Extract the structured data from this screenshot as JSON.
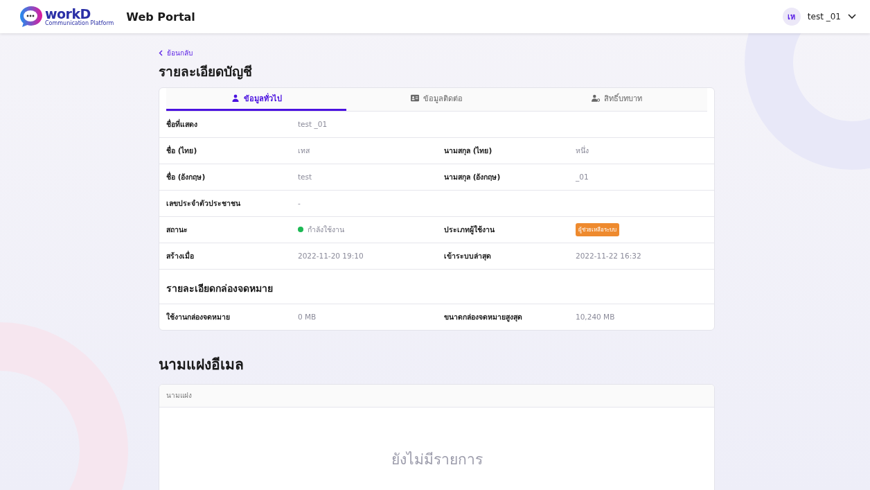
{
  "header": {
    "logo": {
      "name": "workD",
      "tagline": "Communication Platform"
    },
    "title": "Web Portal",
    "user": {
      "initials": "เห",
      "name": "test _01"
    }
  },
  "back_link": "ย้อนกลับ",
  "page_title": "รายละเอียดบัญชี",
  "tabs": [
    {
      "label": "ข้อมูลทั่วไป",
      "selected": true
    },
    {
      "label": "ข้อมูลติดต่อ",
      "selected": false
    },
    {
      "label": "สิทธิ์บทบาท",
      "selected": false
    }
  ],
  "details": [
    {
      "kind": "fields",
      "fields": [
        {
          "label": "ชื่อที่แสดง",
          "value": "test _01"
        }
      ]
    },
    {
      "kind": "fields",
      "fields": [
        {
          "label": "ชื่อ (ไทย)",
          "value": "เทส"
        },
        {
          "label": "นามสกุล (ไทย)",
          "value": "หนึ่ง"
        }
      ]
    },
    {
      "kind": "fields",
      "fields": [
        {
          "label": "ชื่อ (อังกฤษ)",
          "value": "test"
        },
        {
          "label": "นามสกุล (อังกฤษ)",
          "value": "_01"
        }
      ]
    },
    {
      "kind": "fields",
      "fields": [
        {
          "label": "เลขประจำตัวประชาชน",
          "value": "-"
        }
      ]
    },
    {
      "kind": "fields",
      "fields": [
        {
          "label": "สถานะ",
          "value": "กำลังใช้งาน",
          "kind": "status",
          "color": "#1db954"
        },
        {
          "label": "ประเภทผู้ใช้งาน",
          "value": "ผู้ช่วยเหลือระบบ",
          "kind": "badge",
          "color": "#ee8a2e"
        }
      ]
    },
    {
      "kind": "fields",
      "fields": [
        {
          "label": "สร้างเมื่อ",
          "value": "2022-11-20 19:10"
        },
        {
          "label": "เข้าระบบล่าสุด",
          "value": "2022-11-22 16:32"
        }
      ]
    },
    {
      "kind": "heading",
      "text": "รายละเอียดกล่องจดหมาย"
    },
    {
      "kind": "fields",
      "fields": [
        {
          "label": "ใช้งานกล่องจดหมาย",
          "value": "0 MB"
        },
        {
          "label": "ขนาดกล่องจดหมายสูงสุด",
          "value": "10,240 MB"
        }
      ]
    }
  ],
  "alias_section": {
    "title": "นามแฝงอีเมล",
    "table": {
      "columns": [
        "นามแฝง"
      ],
      "empty_text": "ยังไม่มีรายการ"
    }
  }
}
